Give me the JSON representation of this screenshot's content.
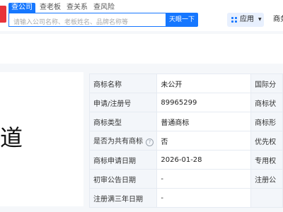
{
  "header": {
    "tabs": [
      {
        "label": "查公司",
        "active": true
      },
      {
        "label": "查老板",
        "active": false
      },
      {
        "label": "查关系",
        "active": false
      },
      {
        "label": "查风险",
        "active": false
      }
    ],
    "search": {
      "placeholder": "请输入公司名称、老板姓名、品牌名称等",
      "value": ""
    },
    "search_button": "天眼一下",
    "apps_label": "应用",
    "biz_label": "商务"
  },
  "brand_display": {
    "char": "道"
  },
  "trademark_info": {
    "rows": [
      {
        "label": "商标名称",
        "value": "未公开",
        "label2": "国际分"
      },
      {
        "label": "申请/注册号",
        "value": "89965299",
        "label2": "商标状"
      },
      {
        "label": "商标类型",
        "value": "普通商标",
        "label2": "商标形"
      },
      {
        "label": "是否为共有商标",
        "value": "否",
        "label2": "优先权",
        "help": true
      },
      {
        "label": "商标申请日期",
        "value": "2026-01-28",
        "label2": "专用权"
      },
      {
        "label": "初审公告日期",
        "value": "-",
        "label2": "注册公"
      },
      {
        "label": "注册满三年日期",
        "value": "-",
        "label2": ""
      }
    ]
  },
  "colors": {
    "accent": "#1677ff",
    "brand_red": "#e8333a",
    "label_bg": "#f3f6fa"
  }
}
